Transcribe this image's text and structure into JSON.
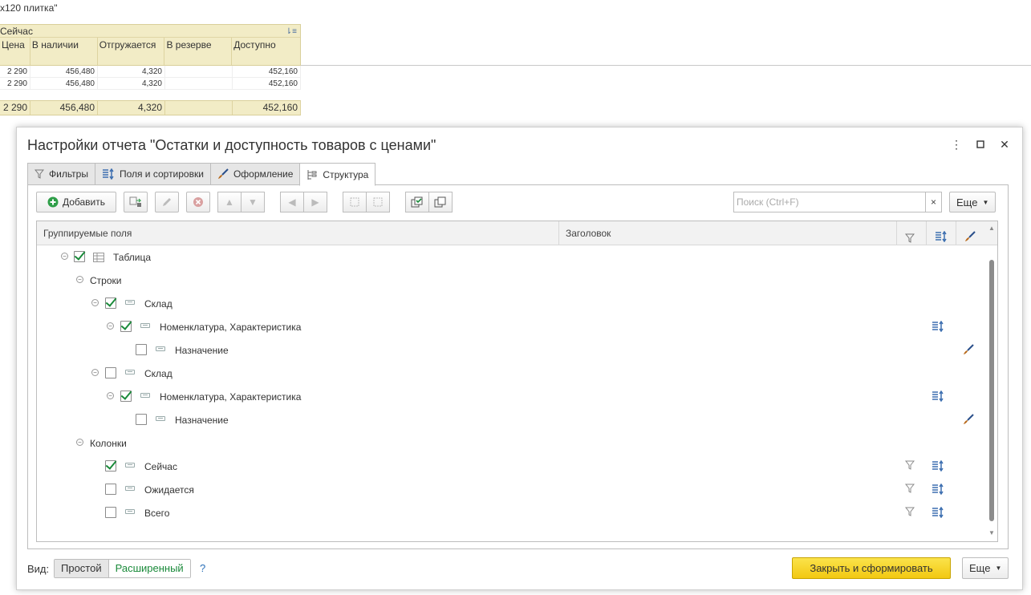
{
  "background": {
    "title_fragment": "x120 плитка\"",
    "group_label": "Сейчас",
    "columns": [
      "Цена",
      "В наличии",
      "Отгружается",
      "В резерве",
      "Доступно"
    ],
    "rows": [
      [
        "2 290",
        "456,480",
        "4,320",
        "",
        "452,160"
      ],
      [
        "2 290",
        "456,480",
        "4,320",
        "",
        "452,160"
      ]
    ],
    "totals": [
      "2 290",
      "456,480",
      "4,320",
      "",
      "452,160"
    ]
  },
  "dialog": {
    "title": "Настройки отчета \"Остатки и доступность товаров  с ценами\"",
    "tabs": [
      {
        "label": "Фильтры",
        "icon": "filter-icon"
      },
      {
        "label": "Поля и сортировки",
        "icon": "fields-sort-icon"
      },
      {
        "label": "Оформление",
        "icon": "brush-icon"
      },
      {
        "label": "Структура",
        "icon": "structure-icon",
        "active": true
      }
    ],
    "toolbar": {
      "add_label": "Добавить",
      "search_placeholder": "Поиск (Ctrl+F)",
      "search_clear": "×",
      "more_label": "Еще"
    },
    "tree": {
      "col_grouped": "Группируемые поля",
      "col_header": "Заголовок",
      "rows": [
        {
          "label": "Таблица",
          "checked": true
        },
        {
          "label": "Строки"
        },
        {
          "label": "Склад",
          "checked": true
        },
        {
          "label": "Номенклатура, Характеристика",
          "checked": true
        },
        {
          "label": "Назначение",
          "checked": false
        },
        {
          "label": "Склад",
          "checked": false
        },
        {
          "label": "Номенклатура, Характеристика",
          "checked": true
        },
        {
          "label": "Назначение",
          "checked": false
        },
        {
          "label": "Колонки"
        },
        {
          "label": "Сейчас",
          "checked": true
        },
        {
          "label": "Ожидается",
          "checked": false
        },
        {
          "label": "Всего",
          "checked": false
        }
      ]
    },
    "footer": {
      "view_label": "Вид:",
      "simple": "Простой",
      "extended": "Расширенный",
      "help": "?",
      "primary": "Закрыть и сформировать",
      "more_label": "Еще"
    },
    "colors": {
      "accent": "#f2c811",
      "check": "#1a8a3a",
      "link": "#1a8a3a"
    }
  }
}
